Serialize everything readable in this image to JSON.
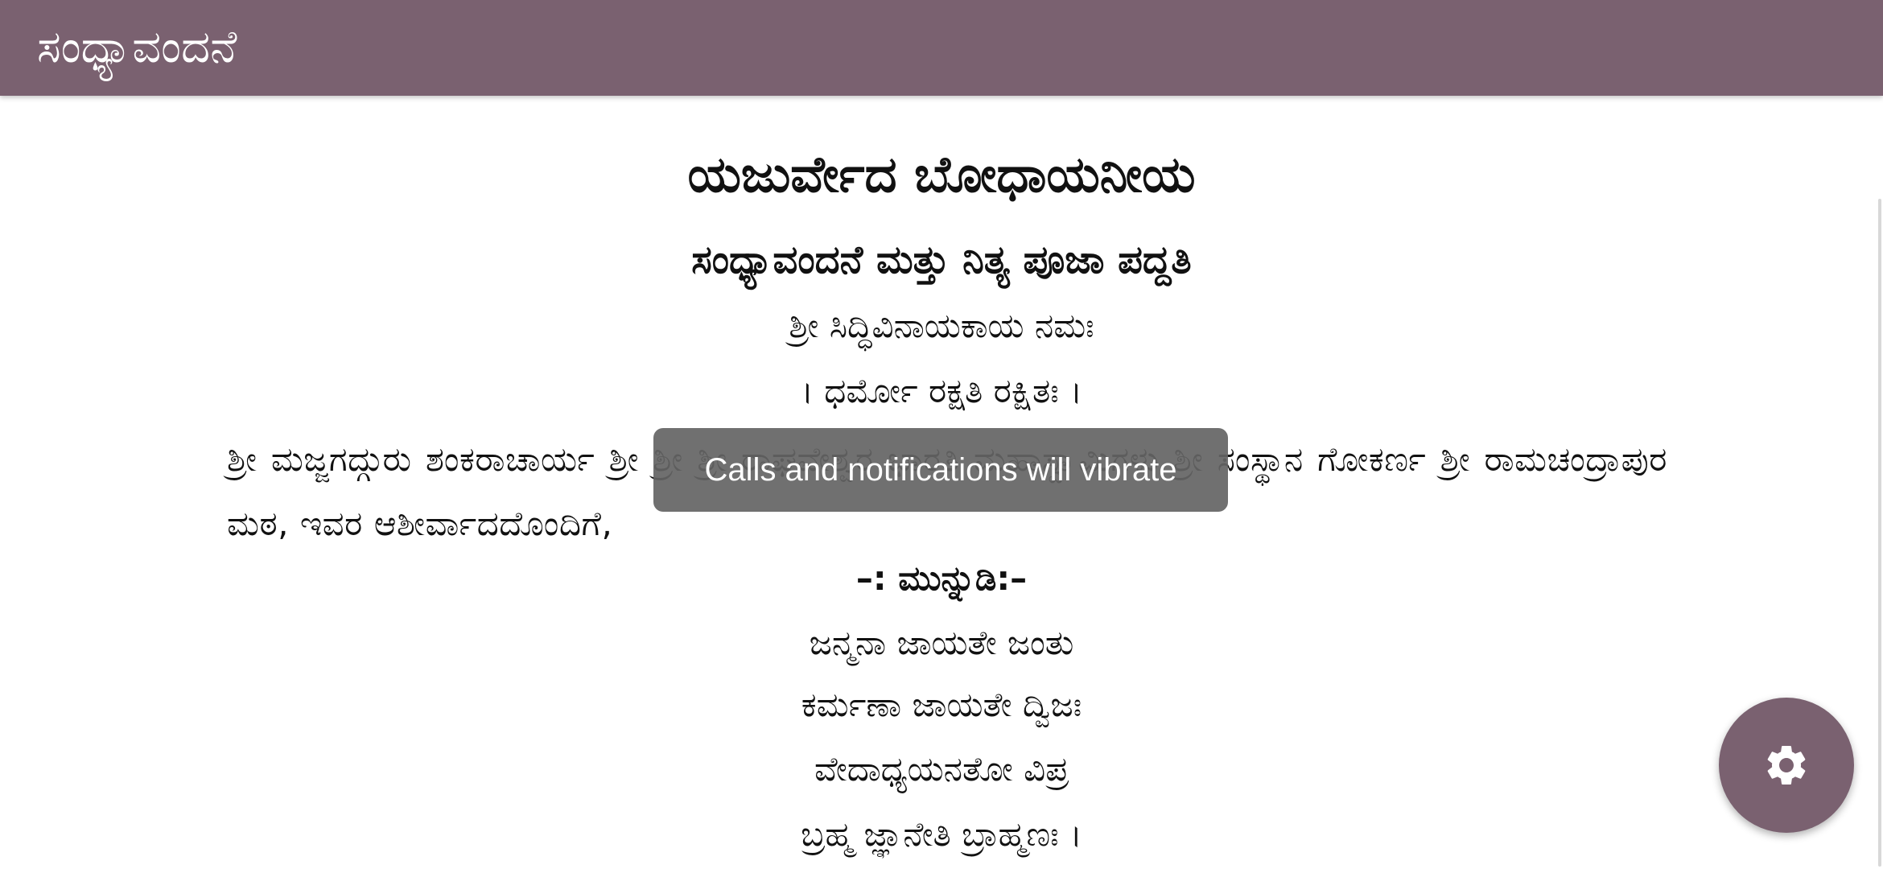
{
  "appbar": {
    "title": "ಸಂಧ್ಯಾವಂದನೆ"
  },
  "content": {
    "title_main": "ಯಜುರ್ವೇದ ಬೋಧಾಯನೀಯ",
    "title_sub": "ಸಂಧ್ಯಾವಂದನೆ ಮತ್ತು ನಿತ್ಯ ಪೂಜಾ ಪದ್ದತಿ",
    "invocation": "ಶ್ರೀ ಸಿದ್ಧಿವಿನಾಯಕಾಯ ನಮಃ",
    "motto": "।  ಧರ್ಮೋ ರಕ್ಷತಿ ರಕ್ಷಿತಃ    ।",
    "blessing_paragraph": "ಶ್ರೀ ಮಜ್ಜಗದ್ಗುರು ಶಂಕರಾಚಾರ್ಯ ಶ್ರೀ ಶ್ರೀ ಶ್ರೀ ರಾಘವೇಶ್ವರ ಭಾರತಿ ಮಹಾಸ್ವಾಮಿಗಳು ಶ್ರೀ ಸಂಸ್ಥಾನ ಗೋಕರ್ಣ ಶ್ರೀ ರಾಮಚಂದ್ರಾಪುರ ಮಠ, ಇವರ ಆಶೀರ್ವಾದದೊಂದಿಗೆ,",
    "preface_heading": "–: ಮುನ್ನುಡಿ:–",
    "verse": [
      "ಜನ್ಮನಾ ಜಾಯತೇ ಜಂತು",
      "ಕರ್ಮಣಾ ಜಾಯತೇ ದ್ವಿಜಃ",
      "ವೇದಾಧ್ಯಯನತೋ ವಿಪ್ರ",
      "ಬ್ರಹ್ಮ ಜ್ಞಾನೇತಿ ಬ್ರಾಹ್ಮಣಃ ।"
    ]
  },
  "toast": {
    "message": "Calls and notifications will vibrate"
  },
  "fab": {
    "icon": "gear-icon"
  },
  "colors": {
    "primary": "#7a6170",
    "toast_bg": "#646464",
    "text": "#111111"
  }
}
